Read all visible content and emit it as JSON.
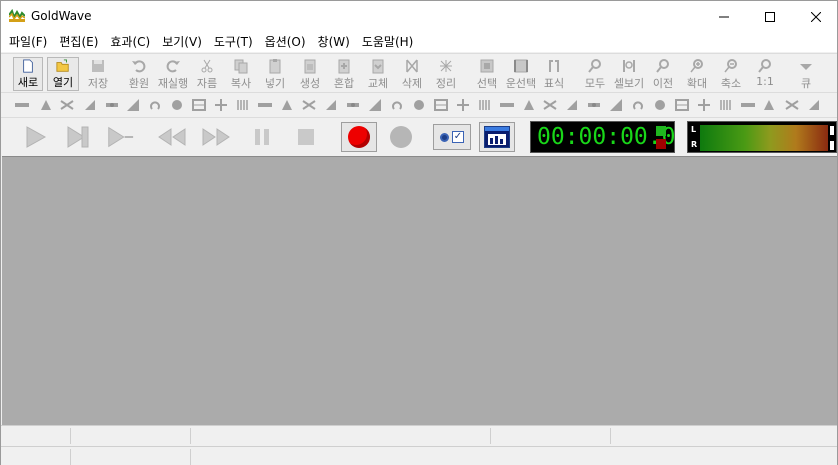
{
  "window": {
    "title": "GoldWave",
    "controls": [
      "minimize",
      "maximize",
      "close"
    ]
  },
  "menu": [
    "파일(F)",
    "편집(E)",
    "효과(C)",
    "보기(V)",
    "도구(T)",
    "옵션(O)",
    "창(W)",
    "도움말(H)"
  ],
  "toolbar": {
    "buttons": [
      {
        "label": "새로",
        "icon": "new-file-icon"
      },
      {
        "label": "열기",
        "icon": "open-folder-icon"
      },
      {
        "label": "저장",
        "icon": "save-icon"
      },
      {
        "label": "환원",
        "icon": "undo-icon"
      },
      {
        "label": "재실행",
        "icon": "redo-icon"
      },
      {
        "label": "자름",
        "icon": "cut-icon"
      },
      {
        "label": "복사",
        "icon": "copy-icon"
      },
      {
        "label": "넣기",
        "icon": "paste-icon"
      },
      {
        "label": "생성",
        "icon": "paste-new-icon"
      },
      {
        "label": "혼합",
        "icon": "mix-icon"
      },
      {
        "label": "교체",
        "icon": "replace-icon"
      },
      {
        "label": "삭제",
        "icon": "delete-icon"
      },
      {
        "label": "정리",
        "icon": "trim-icon"
      },
      {
        "label": "선택",
        "icon": "select-icon"
      },
      {
        "label": "운선택",
        "icon": "select-view-icon"
      },
      {
        "label": "표식",
        "icon": "marker-icon"
      },
      {
        "label": "모두",
        "icon": "zoom-all-icon"
      },
      {
        "label": "셀보기",
        "icon": "zoom-selection-icon"
      },
      {
        "label": "이전",
        "icon": "zoom-previous-icon"
      },
      {
        "label": "확대",
        "icon": "zoom-in-icon"
      },
      {
        "label": "축소",
        "icon": "zoom-out-icon"
      },
      {
        "label": "1:1",
        "icon": "zoom-1to1-icon"
      },
      {
        "label": "큐",
        "icon": "cue-icon"
      }
    ]
  },
  "effects_toolbar": {
    "icons": [
      "doppler-icon",
      "dynamics-icon",
      "echo-icon",
      "fade-in-icon",
      "fade-out-icon",
      "invert-icon",
      "mechanize-icon",
      "noise-reduction-icon",
      "offset-icon",
      "pan-icon",
      "pitch-icon",
      "reverb-icon",
      "reverse-icon",
      "silence-icon",
      "time-warp-icon",
      "volume-change-icon",
      "volume-shape-icon",
      "equalizer-icon",
      "filter-icon",
      "bandpass-icon",
      "lowpass-icon",
      "highpass-icon",
      "spectrum-icon",
      "compressor-icon",
      "flanger-icon",
      "stereo-icon",
      "channel-mixer-icon",
      "resample-icon",
      "interpolate-icon",
      "mute-icon",
      "playback-rate-icon",
      "auto-trim-icon",
      "auto-gain-icon",
      "pop-filter-icon",
      "clip-icon",
      "declick-icon",
      "denoise-icon",
      "hz-icon",
      "hz2-icon",
      "settings-icon",
      "lock-icon"
    ]
  },
  "transport": {
    "time": "00:00:00.0",
    "meter_labels": [
      "L",
      "R"
    ]
  },
  "colors": {
    "workarea": "#ababab",
    "timer_text": "#19d719",
    "record": "#ee0000"
  }
}
